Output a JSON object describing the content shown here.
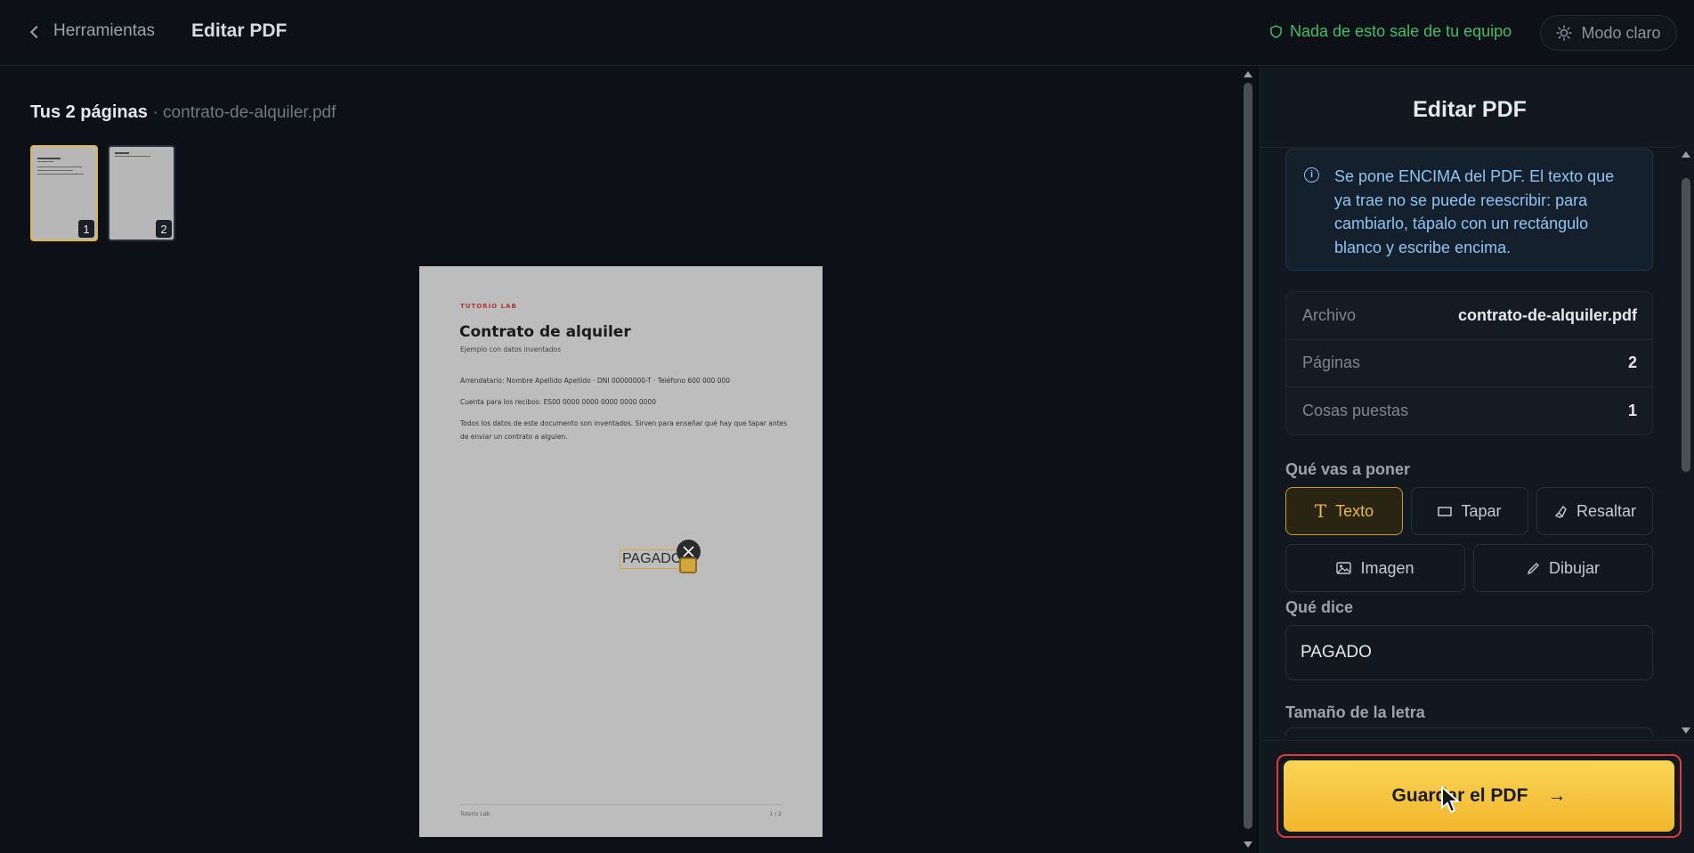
{
  "header": {
    "back_label": "Herramientas",
    "title": "Editar PDF",
    "privacy_text": "Nada de esto sale de tu equipo",
    "mode_label": "Modo claro"
  },
  "canvas": {
    "pages_heading": "Tus 2 páginas",
    "file_suffix": "· contrato-de-alquiler.pdf",
    "thumbnails": [
      {
        "number": "1"
      },
      {
        "number": "2"
      }
    ]
  },
  "pdf": {
    "brand": "TUTORIO LAB",
    "title": "Contrato de alquiler",
    "subtitle": "Ejemplo con datos inventados",
    "line1": "Arrendatario: Nombre Apellido Apellido · DNI 00000000-T · Teléfono 600 000 000",
    "line2": "Cuenta para los recibos: ES00 0000 0000 0000 0000 0000",
    "line3": "Todos los datos de este documento son inventados. Sirven para enseñar qué hay que tapar antes de enviar un contrato a alguien.",
    "footer_left": "Tutorio Lab",
    "footer_right": "1 / 2",
    "placed_text": "PAGADO"
  },
  "panel": {
    "title": "Editar PDF",
    "info": "Se pone ENCIMA del PDF. El texto que ya trae no se puede reescribir: para cambiarlo, tápalo con un rectángulo blanco y escribe encima.",
    "stats": [
      {
        "label": "Archivo",
        "value": "contrato-de-alquiler.pdf"
      },
      {
        "label": "Páginas",
        "value": "2"
      },
      {
        "label": "Cosas puestas",
        "value": "1"
      }
    ],
    "what_label": "Qué vas a poner",
    "tools": {
      "texto": "Texto",
      "tapar": "Tapar",
      "resaltar": "Resaltar",
      "imagen": "Imagen",
      "dibujar": "Dibujar"
    },
    "says_label": "Qué dice",
    "says_value": "PAGADO",
    "size_label": "Tamaño de la letra",
    "save_label": "Guardar el PDF",
    "save_arrow": "→"
  },
  "colors": {
    "accent": "#f3b62c",
    "privacy": "#3fbf6a",
    "info_text": "#8ec4f2",
    "highlight_outline": "#e03b3b"
  }
}
